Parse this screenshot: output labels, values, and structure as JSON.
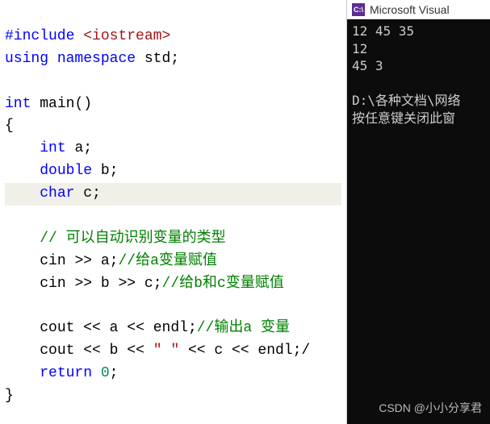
{
  "editor": {
    "line1_pre": "#include",
    "line1_lib": "<iostream>",
    "line2_kw1": "using",
    "line2_kw2": "namespace",
    "line2_ns": "std",
    "main_type": "int",
    "main_name": "main",
    "brace_open": "{",
    "decl_int": "int",
    "decl_a": "a",
    "decl_double": "double",
    "decl_b": "b",
    "decl_char": "char",
    "decl_c": "c",
    "comment_block": "// 可以自动识别变量的类型",
    "cin1_cin": "cin",
    "cin1_op": ">>",
    "cin1_var": "a",
    "cin1_comment": "//给a变量赋值",
    "cin2_cin": "cin",
    "cin2_op1": ">>",
    "cin2_var1": "b",
    "cin2_op2": ">>",
    "cin2_var2": "c",
    "cin2_comment": "//给b和c变量赋值",
    "cout1_cout": "cout",
    "cout1_op1": "<<",
    "cout1_var": "a",
    "cout1_op2": "<<",
    "cout1_endl": "endl",
    "cout1_comment": "//输出a 变量",
    "cout2_cout": "cout",
    "cout2_op1": "<<",
    "cout2_var1": "b",
    "cout2_op2": "<<",
    "cout2_str": "\" \"",
    "cout2_op3": "<<",
    "cout2_var2": "c",
    "cout2_op4": "<<",
    "cout2_endl": "endl",
    "cout2_trail": ";/",
    "return_kw": "return",
    "return_val": "0",
    "brace_close": "}",
    "semi": ";",
    "paren": "()"
  },
  "console": {
    "title": "Microsoft Visual",
    "icon": "C:\\",
    "line1": "12 45 35",
    "line2": "12",
    "line3": "45 3",
    "path": "D:\\各种文档\\网络",
    "prompt": "按任意键关闭此窗"
  },
  "watermark": "CSDN @小小分享君"
}
